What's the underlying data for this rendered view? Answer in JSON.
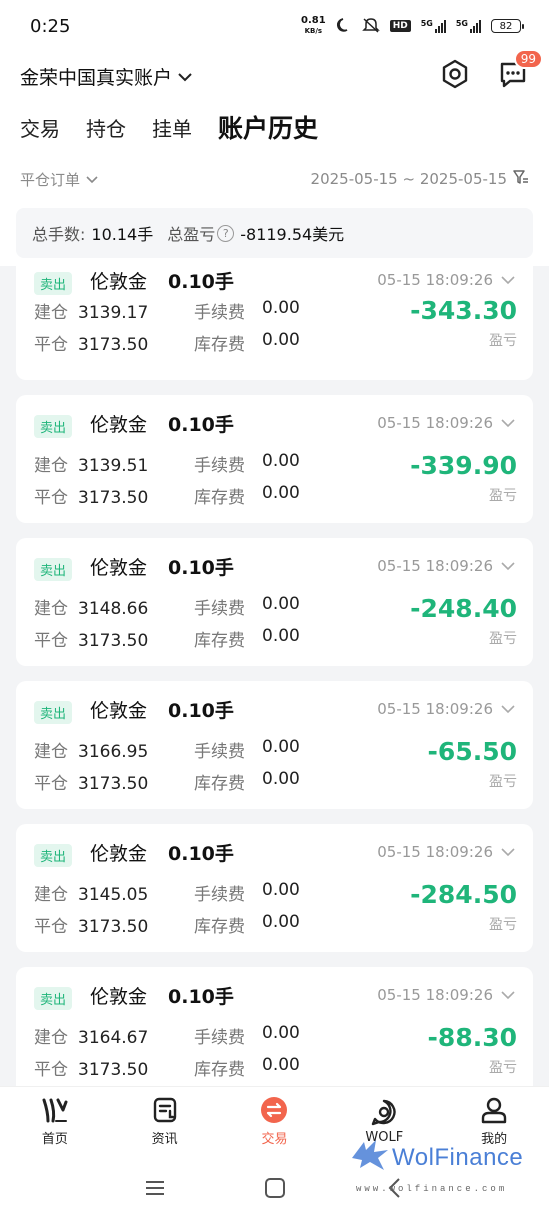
{
  "status_bar": {
    "time": "0:25",
    "net_speed_value": "0.81",
    "net_speed_unit": "KB/s",
    "hd_label": "HD",
    "signal1_label": "5G",
    "signal2_label": "5G",
    "battery": "82"
  },
  "header": {
    "account_title": "金荣中国真实账户",
    "message_badge": "99"
  },
  "tabs": [
    {
      "label": "交易",
      "active": false
    },
    {
      "label": "持仓",
      "active": false
    },
    {
      "label": "挂单",
      "active": false
    },
    {
      "label": "账户历史",
      "active": true
    }
  ],
  "filter": {
    "order_type": "平仓订单",
    "date_range": "2025-05-15 ~ 2025-05-15"
  },
  "summary": {
    "total_lots_label": "总手数:",
    "total_lots_value": "10.14手",
    "total_pnl_label": "总盈亏",
    "total_pnl_help": "?",
    "total_pnl_value": "-8119.54美元"
  },
  "orders": [
    {
      "side": "卖出",
      "symbol": "伦敦金",
      "lots": "0.10手",
      "time": "05-15 18:09:26",
      "open_label": "建仓",
      "open_price": "3139.17",
      "close_label": "平仓",
      "close_price": "3173.50",
      "fee_label": "手续费",
      "fee": "0.00",
      "swap_label": "库存费",
      "swap": "0.00",
      "pnl": "-343.30",
      "pnl_label": "盈亏"
    },
    {
      "side": "卖出",
      "symbol": "伦敦金",
      "lots": "0.10手",
      "time": "05-15 18:09:26",
      "open_label": "建仓",
      "open_price": "3139.51",
      "close_label": "平仓",
      "close_price": "3173.50",
      "fee_label": "手续费",
      "fee": "0.00",
      "swap_label": "库存费",
      "swap": "0.00",
      "pnl": "-339.90",
      "pnl_label": "盈亏"
    },
    {
      "side": "卖出",
      "symbol": "伦敦金",
      "lots": "0.10手",
      "time": "05-15 18:09:26",
      "open_label": "建仓",
      "open_price": "3148.66",
      "close_label": "平仓",
      "close_price": "3173.50",
      "fee_label": "手续费",
      "fee": "0.00",
      "swap_label": "库存费",
      "swap": "0.00",
      "pnl": "-248.40",
      "pnl_label": "盈亏"
    },
    {
      "side": "卖出",
      "symbol": "伦敦金",
      "lots": "0.10手",
      "time": "05-15 18:09:26",
      "open_label": "建仓",
      "open_price": "3166.95",
      "close_label": "平仓",
      "close_price": "3173.50",
      "fee_label": "手续费",
      "fee": "0.00",
      "swap_label": "库存费",
      "swap": "0.00",
      "pnl": "-65.50",
      "pnl_label": "盈亏"
    },
    {
      "side": "卖出",
      "symbol": "伦敦金",
      "lots": "0.10手",
      "time": "05-15 18:09:26",
      "open_label": "建仓",
      "open_price": "3145.05",
      "close_label": "平仓",
      "close_price": "3173.50",
      "fee_label": "手续费",
      "fee": "0.00",
      "swap_label": "库存费",
      "swap": "0.00",
      "pnl": "-284.50",
      "pnl_label": "盈亏"
    },
    {
      "side": "卖出",
      "symbol": "伦敦金",
      "lots": "0.10手",
      "time": "05-15 18:09:26",
      "open_label": "建仓",
      "open_price": "3164.67",
      "close_label": "平仓",
      "close_price": "3173.50",
      "fee_label": "手续费",
      "fee": "0.00",
      "swap_label": "库存费",
      "swap": "0.00",
      "pnl": "-88.30",
      "pnl_label": "盈亏"
    }
  ],
  "bottom_nav": [
    {
      "label": "首页",
      "icon": "home-logo-icon",
      "active": false
    },
    {
      "label": "资讯",
      "icon": "news-icon",
      "active": false
    },
    {
      "label": "交易",
      "icon": "trade-swap-icon",
      "active": true
    },
    {
      "label": "WOLF",
      "icon": "wolf-chat-icon",
      "active": false
    },
    {
      "label": "我的",
      "icon": "profile-icon",
      "active": false
    }
  ],
  "watermark": {
    "brand": "WolFinance",
    "url": "www.wolfinance.com"
  },
  "colors": {
    "accent": "#f2654d",
    "profit_green": "#1fb57a",
    "badge_bg": "#e3f6ee",
    "watermark_blue": "#4a7fd6"
  }
}
